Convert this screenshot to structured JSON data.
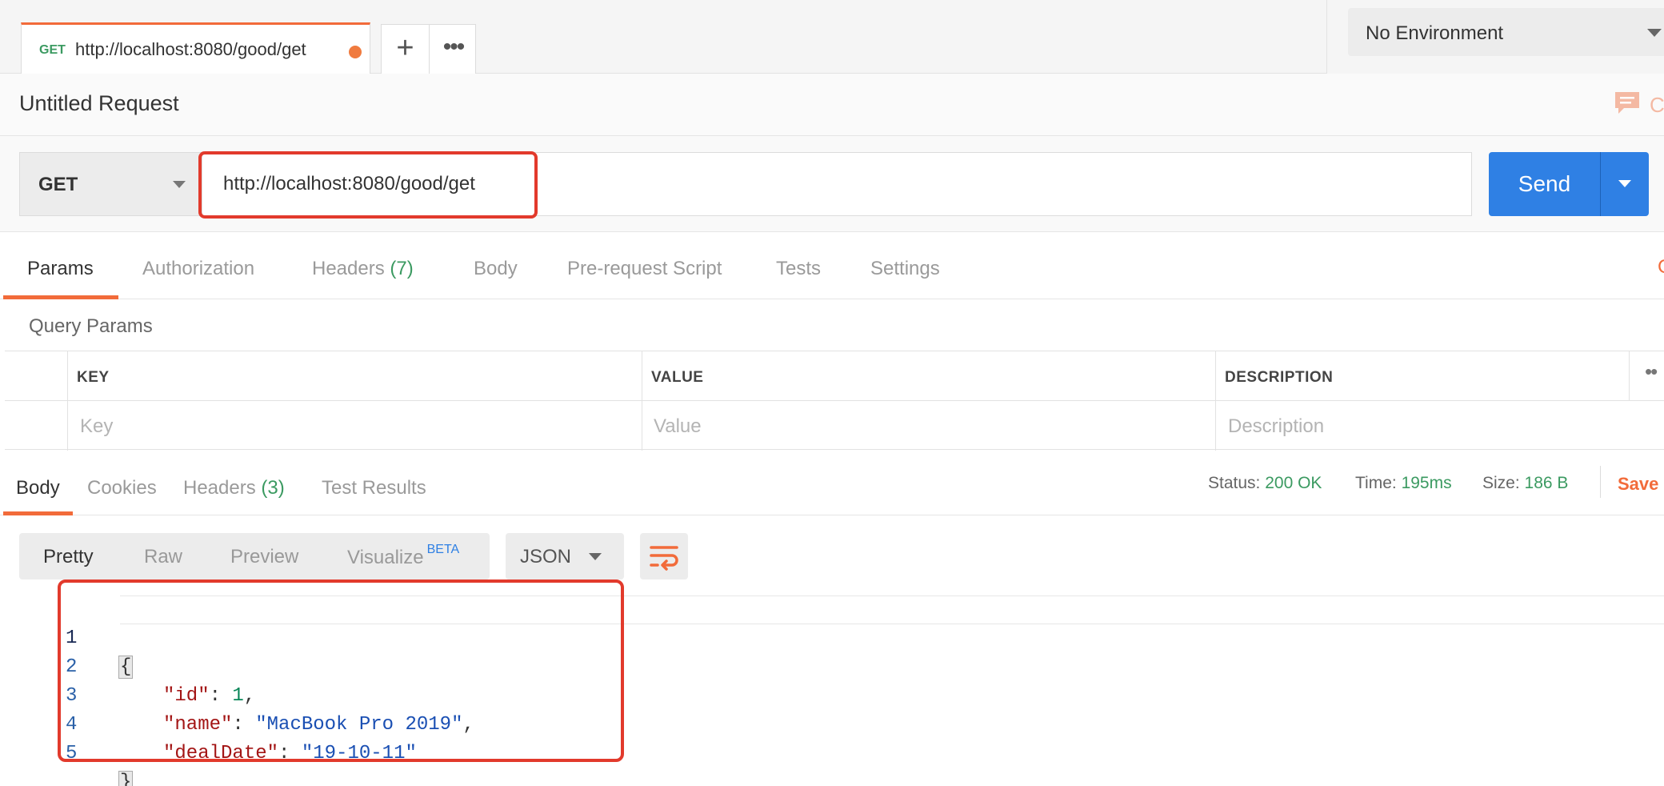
{
  "tab": {
    "method": "GET",
    "url": "http://localhost:8080/good/get",
    "unsaved_dot_color": "#f07b3f",
    "new_tab_icon": "plus-icon",
    "more_icon": "more-horizontal-icon"
  },
  "environment": {
    "selected": "No Environment"
  },
  "request": {
    "title": "Untitled Request",
    "comments_label": "C",
    "method": "GET",
    "url": "http://localhost:8080/good/get",
    "send_label": "Send"
  },
  "request_tabs": {
    "params": "Params",
    "authorization": "Authorization",
    "headers": "Headers",
    "headers_count": "(7)",
    "body": "Body",
    "pre_request_script": "Pre-request Script",
    "tests": "Tests",
    "settings": "Settings",
    "edge_label": "C"
  },
  "query_params": {
    "title": "Query Params",
    "columns": [
      "KEY",
      "VALUE",
      "DESCRIPTION"
    ],
    "placeholders": [
      "Key",
      "Value",
      "Description"
    ]
  },
  "response": {
    "tabs": {
      "body": "Body",
      "cookies": "Cookies",
      "headers": "Headers",
      "headers_count": "(3)",
      "test_results": "Test Results"
    },
    "status_label": "Status:",
    "status_value": "200 OK",
    "time_label": "Time:",
    "time_value": "195ms",
    "size_label": "Size:",
    "size_value": "186 B",
    "save_label": "Save",
    "views": {
      "pretty": "Pretty",
      "raw": "Raw",
      "preview": "Preview",
      "visualize": "Visualize",
      "beta": "BETA"
    },
    "format": "JSON",
    "wrap_icon": "wrap-lines-icon",
    "code": {
      "line_numbers": [
        "1",
        "2",
        "3",
        "4",
        "5"
      ],
      "open_brace": "{",
      "close_brace": "}",
      "id_key": "\"id\"",
      "id_value": "1",
      "name_key": "\"name\"",
      "name_value": "\"MacBook Pro 2019\"",
      "date_key": "\"dealDate\"",
      "date_value": "\"19-10-11\""
    }
  },
  "colors": {
    "accent": "#f26b3a",
    "send_blue": "#2f80e4",
    "success_green": "#3b9a61",
    "highlight_red": "#e23a2c"
  }
}
